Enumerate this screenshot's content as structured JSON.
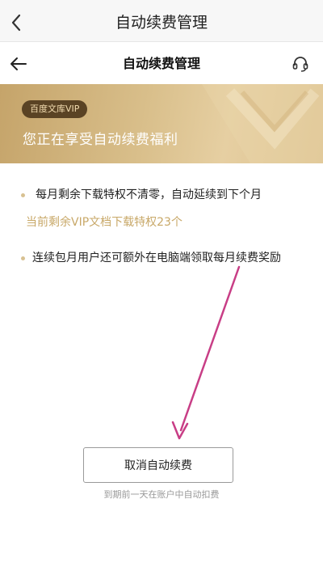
{
  "outer_header": {
    "title": "自动续费管理"
  },
  "inner_header": {
    "title": "自动续费管理"
  },
  "banner": {
    "badge": "百度文库VIP",
    "headline": "您正在享受自动续费福利"
  },
  "benefits": {
    "item1": "每月剩余下载特权不清零，自动延续到下个月",
    "item1_sub": "当前剩余VIP文档下载特权23个",
    "item2": "连续包月用户还可额外在电脑端领取每月续费奖励"
  },
  "action": {
    "cancel_label": "取消自动续费",
    "hint": "到期前一天在账户中自动扣费"
  },
  "colors": {
    "gold_text": "#c8a868",
    "badge_bg": "#5a4324",
    "annotation_arrow": "#c83e86"
  },
  "icons": {
    "outer_back": "chevron-left-icon",
    "inner_back": "arrow-left-icon",
    "support": "headset-icon"
  }
}
